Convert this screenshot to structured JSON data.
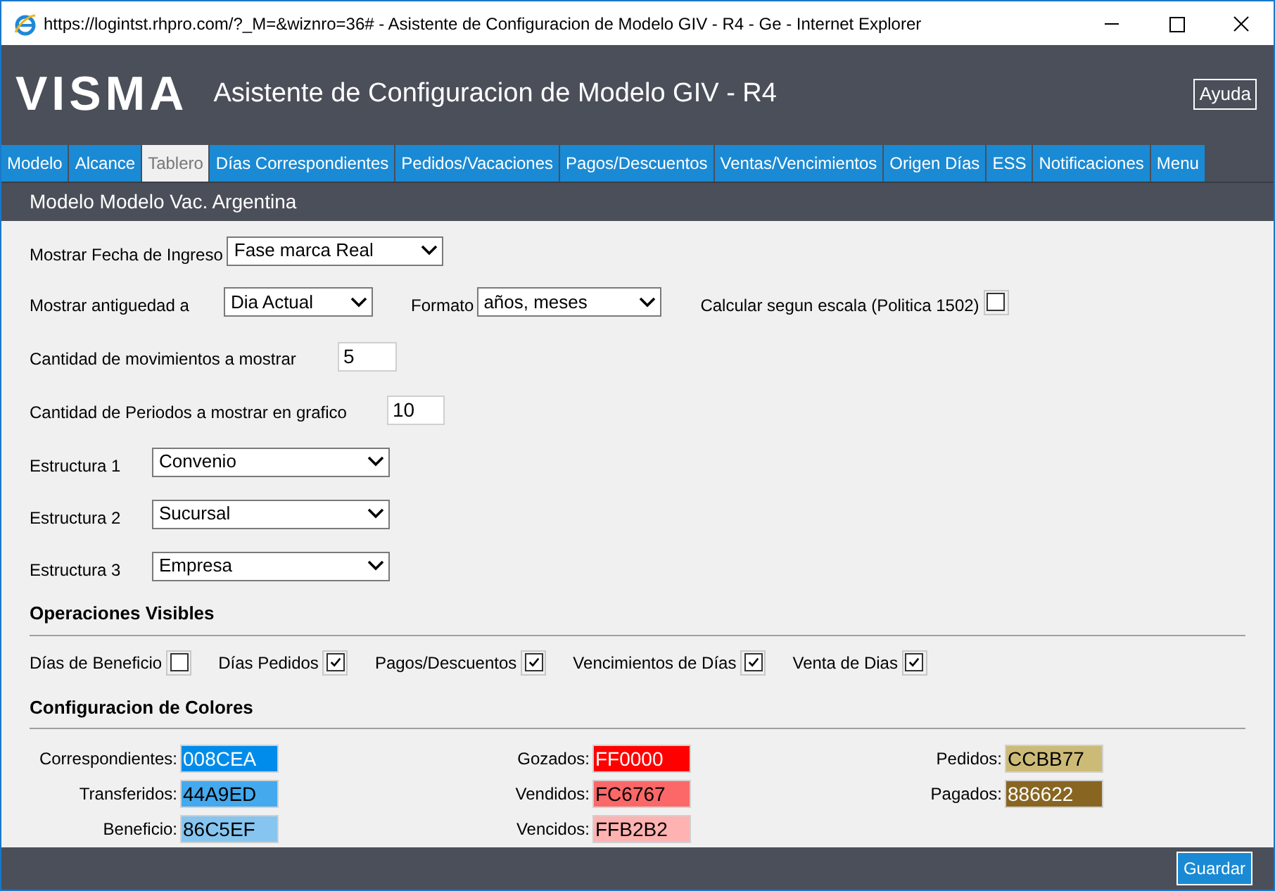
{
  "window": {
    "title": "https://logintst.rhpro.com/?_M=&wiznro=36# - Asistente de Configuracion de Modelo GIV - R4 - Ge - Internet Explorer"
  },
  "header": {
    "logo": "VISMA",
    "title": "Asistente de Configuracion de Modelo GIV - R4",
    "help_button": "Ayuda"
  },
  "tabs": [
    {
      "label": "Modelo",
      "selected": false
    },
    {
      "label": "Alcance",
      "selected": false
    },
    {
      "label": "Tablero",
      "selected": true
    },
    {
      "label": "Días Correspondientes",
      "selected": false
    },
    {
      "label": "Pedidos/Vacaciones",
      "selected": false
    },
    {
      "label": "Pagos/Descuentos",
      "selected": false
    },
    {
      "label": "Ventas/Vencimientos",
      "selected": false
    },
    {
      "label": "Origen Días",
      "selected": false
    },
    {
      "label": "ESS",
      "selected": false
    },
    {
      "label": "Notificaciones",
      "selected": false
    },
    {
      "label": "Menu",
      "selected": false
    }
  ],
  "subheader": "Modelo Modelo Vac. Argentina",
  "form": {
    "fecha_ingreso": {
      "label": "Mostrar Fecha de Ingreso",
      "value": "Fase marca Real"
    },
    "antiguedad": {
      "label": "Mostrar antiguedad a",
      "value": "Dia Actual"
    },
    "formato": {
      "label": "Formato",
      "value": "años, meses"
    },
    "calcular_escala": {
      "label": "Calcular segun escala (Politica 1502)",
      "checked": false
    },
    "movimientos": {
      "label": "Cantidad de movimientos a mostrar",
      "value": "5"
    },
    "periodos": {
      "label": "Cantidad de Periodos a mostrar en grafico",
      "value": "10"
    },
    "estructuras": [
      {
        "label": "Estructura 1",
        "value": "Convenio"
      },
      {
        "label": "Estructura 2",
        "value": "Sucursal"
      },
      {
        "label": "Estructura 3",
        "value": "Empresa"
      }
    ]
  },
  "operaciones": {
    "title": "Operaciones Visibles",
    "items": [
      {
        "label": "Días de Beneficio",
        "checked": false
      },
      {
        "label": "Días Pedidos",
        "checked": true
      },
      {
        "label": "Pagos/Descuentos",
        "checked": true
      },
      {
        "label": "Vencimientos de Días",
        "checked": true
      },
      {
        "label": "Venta de Dias",
        "checked": true
      }
    ]
  },
  "colores": {
    "title": "Configuracion de Colores",
    "columns": [
      [
        {
          "label": "Correspondientes:",
          "value": "008CEA",
          "color": "#008cea"
        },
        {
          "label": "Transferidos:",
          "value": "44A9ED",
          "color": "#44a9ed"
        },
        {
          "label": "Beneficio:",
          "value": "86C5EF",
          "color": "#86c5ef"
        }
      ],
      [
        {
          "label": "Gozados:",
          "value": "FF0000",
          "color": "#ff0000"
        },
        {
          "label": "Vendidos:",
          "value": "FC6767",
          "color": "#fc6767"
        },
        {
          "label": "Vencidos:",
          "value": "FFB2B2",
          "color": "#ffb2b2"
        }
      ],
      [
        {
          "label": "Pedidos:",
          "value": "CCBB77",
          "color": "#ccbb77"
        },
        {
          "label": "Pagados:",
          "value": "886622",
          "color": "#886622"
        }
      ]
    ]
  },
  "footer": {
    "save_button": "Guardar"
  }
}
